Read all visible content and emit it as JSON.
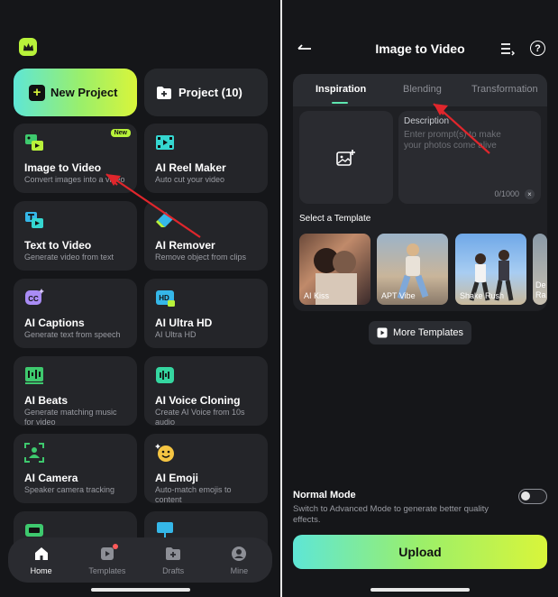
{
  "left": {
    "new_project": "New Project",
    "project": "Project (10)",
    "badge_new": "New",
    "cards": [
      {
        "title": "Image to Video",
        "desc": "Convert images into a video",
        "icon": "image-to-video-icon"
      },
      {
        "title": "AI Reel Maker",
        "desc": "Auto cut your video",
        "icon": "reel-maker-icon"
      },
      {
        "title": "Text to Video",
        "desc": "Generate video from text",
        "icon": "text-to-video-icon"
      },
      {
        "title": "AI Remover",
        "desc": "Remove object from clips",
        "icon": "eraser-icon"
      },
      {
        "title": "AI Captions",
        "desc": "Generate text from speech",
        "icon": "captions-icon"
      },
      {
        "title": "AI Ultra HD",
        "desc": "AI Ultra HD",
        "icon": "hd-icon"
      },
      {
        "title": "AI Beats",
        "desc": "Generate matching music for video",
        "icon": "beats-icon"
      },
      {
        "title": "AI Voice Cloning",
        "desc": "Create AI Voice from 10s audio",
        "icon": "voice-clone-icon"
      },
      {
        "title": "AI Camera",
        "desc": "Speaker camera tracking",
        "icon": "camera-tracking-icon"
      },
      {
        "title": "AI Emoji",
        "desc": "Auto-match emojis to content",
        "icon": "emoji-icon"
      }
    ],
    "nav": [
      {
        "label": "Home",
        "icon": "home-icon"
      },
      {
        "label": "Templates",
        "icon": "templates-icon"
      },
      {
        "label": "Drafts",
        "icon": "drafts-icon"
      },
      {
        "label": "Mine",
        "icon": "profile-icon"
      }
    ]
  },
  "right": {
    "title": "Image to Video",
    "tabs": [
      "Inspiration",
      "Blending",
      "Transformation"
    ],
    "desc_label": "Description",
    "desc_placeholder": "Enter prompt(s) to make your photos come alive",
    "char_count": "0/1000",
    "select_template": "Select a Template",
    "templates": [
      "AI Kiss",
      "APT Vibe",
      "Shake Rush",
      "De Ra"
    ],
    "more_templates": "More Templates",
    "normal_mode_title": "Normal Mode",
    "normal_mode_desc": "Switch to Advanced Mode to generate better quality effects.",
    "normal_mode_on": false,
    "upload": "Upload"
  },
  "colors": {
    "accent_green": "#b8f23a",
    "gradient_start": "#5ee6d6",
    "arrow": "#e0262c"
  }
}
